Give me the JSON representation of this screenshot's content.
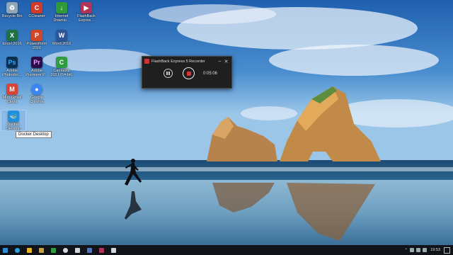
{
  "desktop": {
    "icons": [
      {
        "label": "Recycle Bin",
        "icon": "recycle-bin-icon",
        "color": "#8fa7b8"
      },
      {
        "label": "CCleaner",
        "icon": "ccleaner-icon",
        "color": "#d13b2a"
      },
      {
        "label": "Internet Downlo...",
        "icon": "download-icon",
        "color": "#2f9a3a"
      },
      {
        "label": "FlashBack Expres...",
        "icon": "flashback-icon",
        "color": "#b0335a"
      },
      {
        "label": "Excel 2016",
        "icon": "excel-icon",
        "color": "#1e7145"
      },
      {
        "label": "PowerPoint 2016",
        "icon": "powerpoint-icon",
        "color": "#d24726"
      },
      {
        "label": "Word 2016",
        "icon": "word-icon",
        "color": "#2b579a"
      },
      {
        "label": "Adobe Photosho...",
        "icon": "photoshop-icon",
        "color": "#0b2f4f"
      },
      {
        "label": "Adobe Premiere P...",
        "icon": "premiere-icon",
        "color": "#2a0d48"
      },
      {
        "label": "Camtasia 2021 (64-bit)",
        "icon": "camtasia-icon",
        "color": "#2e9c3f"
      },
      {
        "label": "Miro Gmail Client",
        "icon": "gmail-icon",
        "color": "#d44638"
      },
      {
        "label": "Google Chrome",
        "icon": "chrome-icon",
        "color": "#3b86f0"
      },
      {
        "label": "Docker Desktop",
        "icon": "docker-icon",
        "color": "#1d8fe0"
      }
    ],
    "tooltip": "Docker Desktop"
  },
  "recorder": {
    "title": "FlashBack Express 5 Recorder",
    "minimize": "–",
    "close": "✕",
    "time": "0:05:06"
  },
  "taskbar": {
    "items": [
      {
        "icon": "start-icon",
        "color": "#2c8ed6"
      },
      {
        "icon": "edge-icon",
        "color": "#2aa0e0"
      },
      {
        "icon": "file-explorer-icon",
        "color": "#e8b52a"
      },
      {
        "icon": "app-icon-1",
        "color": "#c8a03a"
      },
      {
        "icon": "app-icon-2",
        "color": "#2e9a46"
      },
      {
        "icon": "settings-icon",
        "color": "#cfd6dc"
      },
      {
        "icon": "app-icon-3",
        "color": "#cfd6dc"
      },
      {
        "icon": "app-icon-4",
        "color": "#4a78c6"
      },
      {
        "icon": "flashback-taskbar-icon",
        "color": "#b0335a"
      },
      {
        "icon": "app-icon-5",
        "color": "#cfd6dc"
      }
    ],
    "clock": "19:53"
  }
}
